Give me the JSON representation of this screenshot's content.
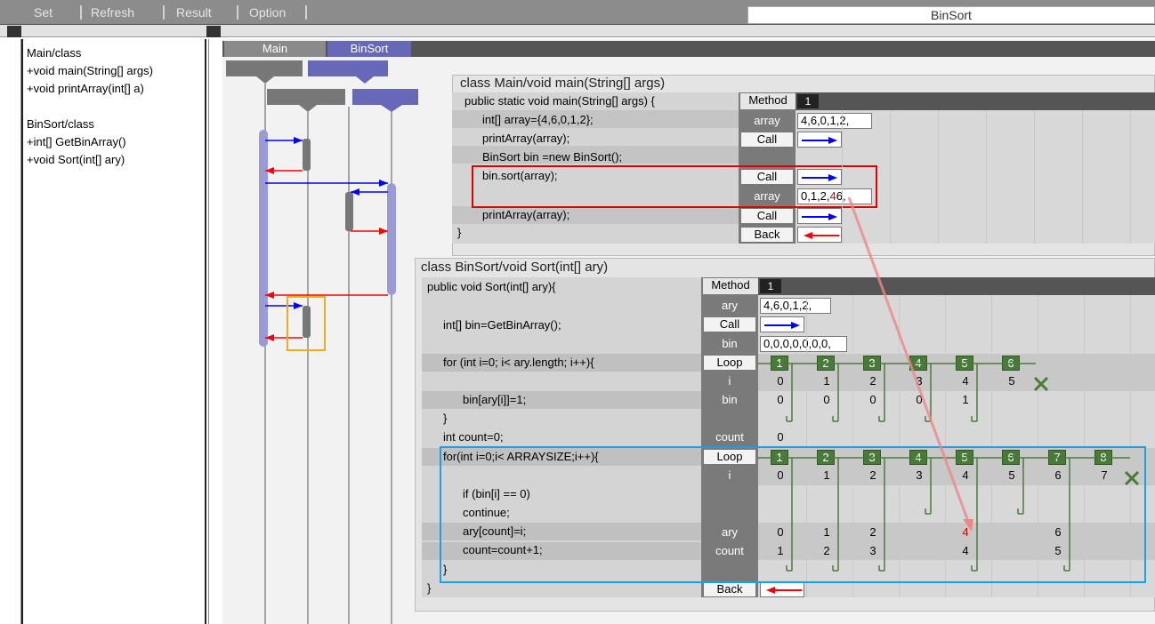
{
  "menu": {
    "items": [
      "Set",
      "Refresh",
      "Result",
      "Option"
    ],
    "title": "BinSort"
  },
  "outline": [
    "Main/class",
    "+void main(String[] args)",
    "+void printArray(int[] a)",
    "",
    "BinSort/class",
    "+int[]  GetBinArray()",
    "+void Sort(int[] ary)"
  ],
  "classes": {
    "main": "Main",
    "binsort": "BinSort"
  },
  "methods": {
    "main": "main",
    "getbinarray": "GetBinArray",
    "printarray": "printArray",
    "sort": "Sort"
  },
  "main_panel": {
    "title": "class Main/void main(String[] args)",
    "lines": [
      "public static void main(String[] args) {",
      "int[] array={4,6,0,1,2};",
      "printArray(array);",
      "BinSort bin =new BinSort();",
      "bin.sort(array);",
      "",
      "printArray(array);",
      "}"
    ],
    "method_label": "Method",
    "method_num": "1",
    "array_label": "array",
    "array_val": "4,6,0,1,2,",
    "call1": "Call",
    "call2": "Call",
    "array2_label": "array",
    "array2_a": "0,1,2,",
    "array2_b": "4",
    "array2_c": "6,",
    "call3": "Call",
    "back": "Back"
  },
  "sort_panel": {
    "title": "class BinSort/void Sort(int[] ary)",
    "lines": [
      "public void Sort(int[] ary){",
      "",
      "int[] bin=GetBinArray();",
      "",
      "for (int i=0; i< ary.length; i++){",
      "",
      "bin[ary[i]]=1;",
      "}",
      "int count=0;",
      "for(int i=0;i< ARRAYSIZE;i++){",
      "",
      "if (bin[i] == 0)",
      "continue;",
      "ary[count]=i;",
      "count=count+1;",
      "}",
      "}"
    ],
    "method_label": "Method",
    "method_num": "1",
    "ary_label": "ary",
    "ary_val": "4,6,0,1,2,",
    "call": "Call",
    "bin_label": "bin",
    "bin_val": "0,0,0,0,0,0,0,",
    "loop_label": "Loop",
    "i_label": "i",
    "bin_label2": "bin",
    "count_label": "count",
    "ary_label2": "ary",
    "count_label2": "count",
    "back": "Back",
    "loop1": {
      "nums": [
        "1",
        "2",
        "3",
        "4",
        "5",
        "6"
      ],
      "i": [
        "0",
        "1",
        "2",
        "3",
        "4",
        "5"
      ],
      "bin": [
        "0",
        "0",
        "0",
        "0",
        "1"
      ]
    },
    "count0": "0",
    "loop2": {
      "nums": [
        "1",
        "2",
        "3",
        "4",
        "5",
        "6",
        "7",
        "8"
      ],
      "i": [
        "0",
        "1",
        "2",
        "3",
        "4",
        "5",
        "6",
        "7"
      ],
      "ary": [
        "0",
        "1",
        "2",
        "",
        "4",
        "",
        "6"
      ],
      "count": [
        "1",
        "2",
        "3",
        "",
        "4",
        "",
        "5"
      ]
    }
  },
  "colors": {
    "lifeline": "#9a9ad6",
    "call": "#0000ff",
    "ret": "#ff0000",
    "highlight_red": "#e00000",
    "highlight_blue": "#1aa0e6",
    "highlight_orange": "#f5a623",
    "loop_green": "#4a7a3a"
  }
}
